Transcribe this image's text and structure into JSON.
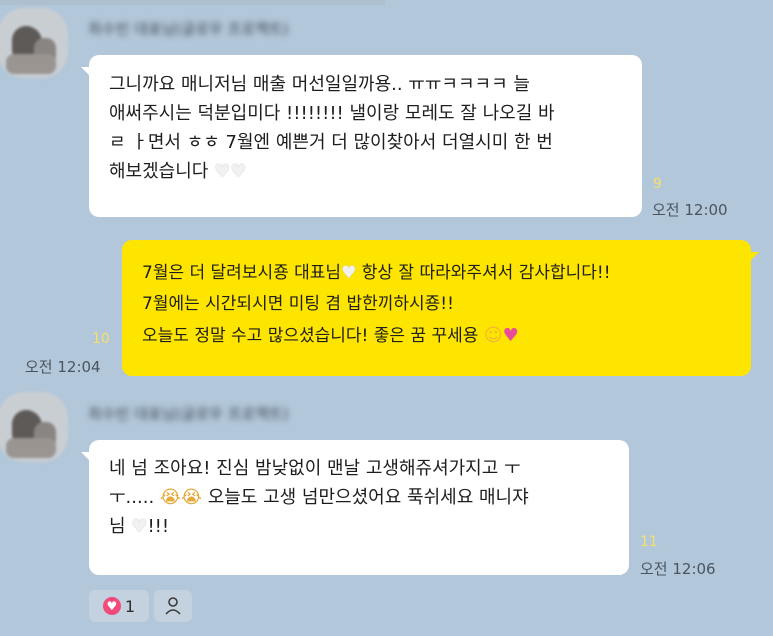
{
  "chat": {
    "messages": [
      {
        "sender": "최수빈 대표님(글로우 프로젝트)",
        "lines": [
          "그니까요 매니저님 매출 머선일일까용.. ㅠㅠㅋㅋㅋㅋ 늘",
          "애써주시는 덕분입미다 !!!!!!!! 낼이랑 모레도 잘 나오길 바",
          "ㄹ ㅏ면서 ㅎㅎ 7월엔 예쁜거 더 많이찾아서 더열시미 한 번",
          "해보겠습니다"
        ],
        "unread": "9",
        "time": "오전 12:00"
      },
      {
        "lines": [
          "7월은 더 달려보시죵 대표님",
          " 항상 잘 따라와주셔서 감사합니다!!",
          "7월에는 시간되시면 미팅 겸 밥한끼하시죵!!",
          "오늘도 정말 수고 많으셨습니다! 좋은 꿈 꾸세용 "
        ],
        "unread": "10",
        "time": "오전 12:04"
      },
      {
        "sender": "최수빈 대표님(글로우 프로젝트)",
        "lines": [
          "네 넘 조아요! 진심 밤낮없이 맨날 고생해쥬셔가지고 ㅜ",
          "ㅜ..... ",
          " 오늘도 고생 넘만으셨어요 푹쉬세요 매니쟈",
          "님 ",
          "!!!"
        ],
        "unread": "11",
        "time": "오전 12:06"
      }
    ],
    "reaction": {
      "icon": "heart-icon",
      "count": "1"
    },
    "colors": {
      "background": "#b2c7da",
      "my_bubble": "#fee500",
      "their_bubble": "#ffffff",
      "unread": "#f5e16a"
    }
  }
}
